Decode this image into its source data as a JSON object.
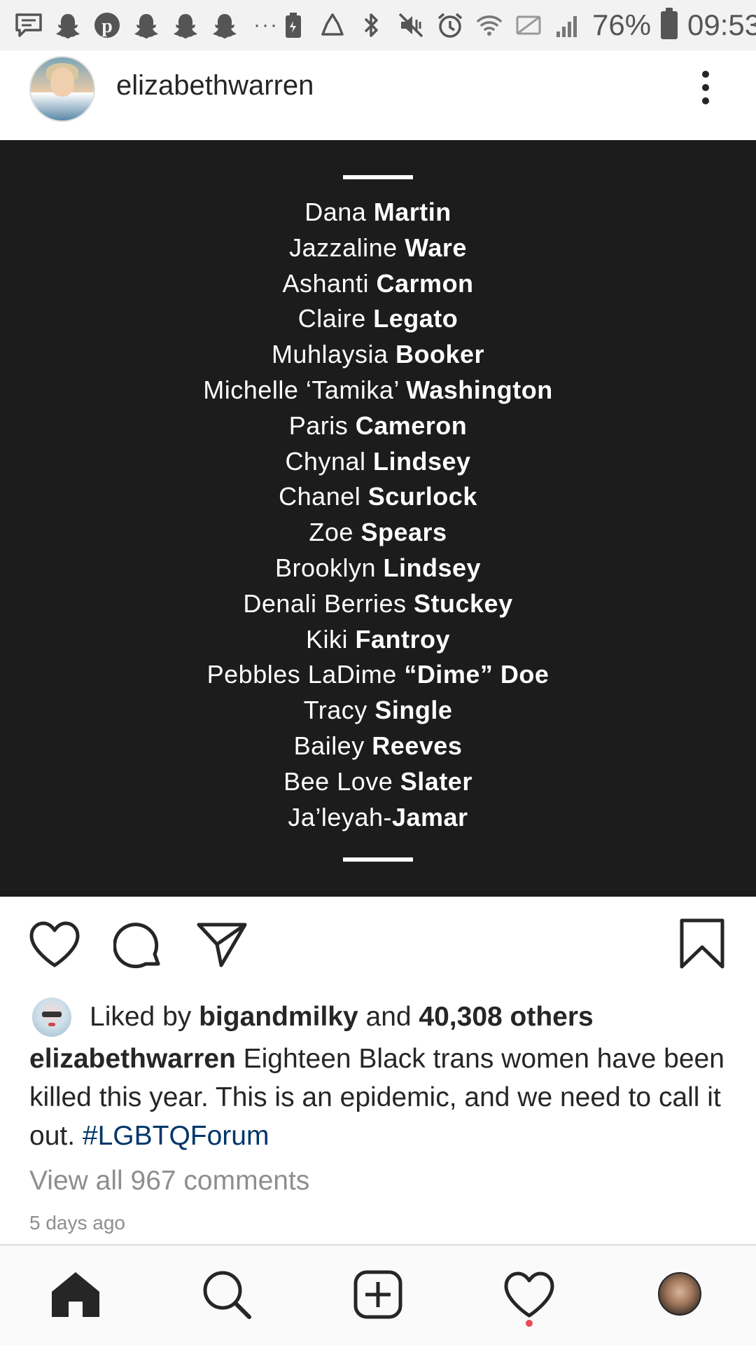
{
  "status_bar": {
    "battery_percent": "76%",
    "time": "09:53",
    "overflow": "···",
    "icons": [
      "message-icon",
      "snapchat-icon",
      "pinterest-icon",
      "snapchat-icon",
      "snapchat-icon",
      "snapchat-icon",
      "battery-saver-icon",
      "recycle-icon",
      "bluetooth-icon",
      "mute-vibrate-icon",
      "alarm-icon",
      "wifi-icon",
      "no-sim-icon",
      "signal-icon",
      "battery-icon"
    ]
  },
  "post": {
    "username": "elizabethwarren",
    "names": [
      {
        "first": "Dana",
        "last": "Martin"
      },
      {
        "first": "Jazzaline",
        "last": "Ware"
      },
      {
        "first": "Ashanti",
        "last": "Carmon"
      },
      {
        "first": "Claire",
        "last": "Legato"
      },
      {
        "first": "Muhlaysia",
        "last": "Booker"
      },
      {
        "first": "Michelle ‘Tamika’",
        "last": "Washington"
      },
      {
        "first": "Paris",
        "last": "Cameron"
      },
      {
        "first": "Chynal",
        "last": "Lindsey"
      },
      {
        "first": "Chanel",
        "last": "Scurlock"
      },
      {
        "first": "Zoe",
        "last": "Spears"
      },
      {
        "first": "Brooklyn",
        "last": "Lindsey"
      },
      {
        "first": "Denali Berries",
        "last": "Stuckey"
      },
      {
        "first": "Kiki",
        "last": "Fantroy"
      },
      {
        "first": "Pebbles LaDime",
        "last": "“Dime” Doe"
      },
      {
        "first": "Tracy",
        "last": "Single"
      },
      {
        "first": "Bailey",
        "last": "Reeves"
      },
      {
        "first": "Bee Love",
        "last": "Slater"
      },
      {
        "first": "Ja’leyah-",
        "last": "Jamar"
      }
    ],
    "likes": {
      "prefix": "Liked by",
      "user": "bigandmilky",
      "conjunction": "and",
      "others": "40,308 others"
    },
    "caption": {
      "username": "elizabethwarren",
      "text": "Eighteen Black trans women have been killed this year. This is an epidemic, and we need to call it out.",
      "hashtag": "#LGBTQForum"
    },
    "view_comments": "View all 967 comments",
    "timestamp": "5 days ago"
  },
  "actions": [
    "heart-icon",
    "comment-icon",
    "share-icon",
    "bookmark-icon"
  ],
  "bottom_nav": [
    "home-icon",
    "search-icon",
    "add-post-icon",
    "activity-heart-icon",
    "profile-avatar"
  ],
  "colors": {
    "post_background": "#1c1c1c",
    "hashtag": "#003569",
    "muted_text": "#8e8e8e",
    "notification_dot": "#ed4956"
  }
}
